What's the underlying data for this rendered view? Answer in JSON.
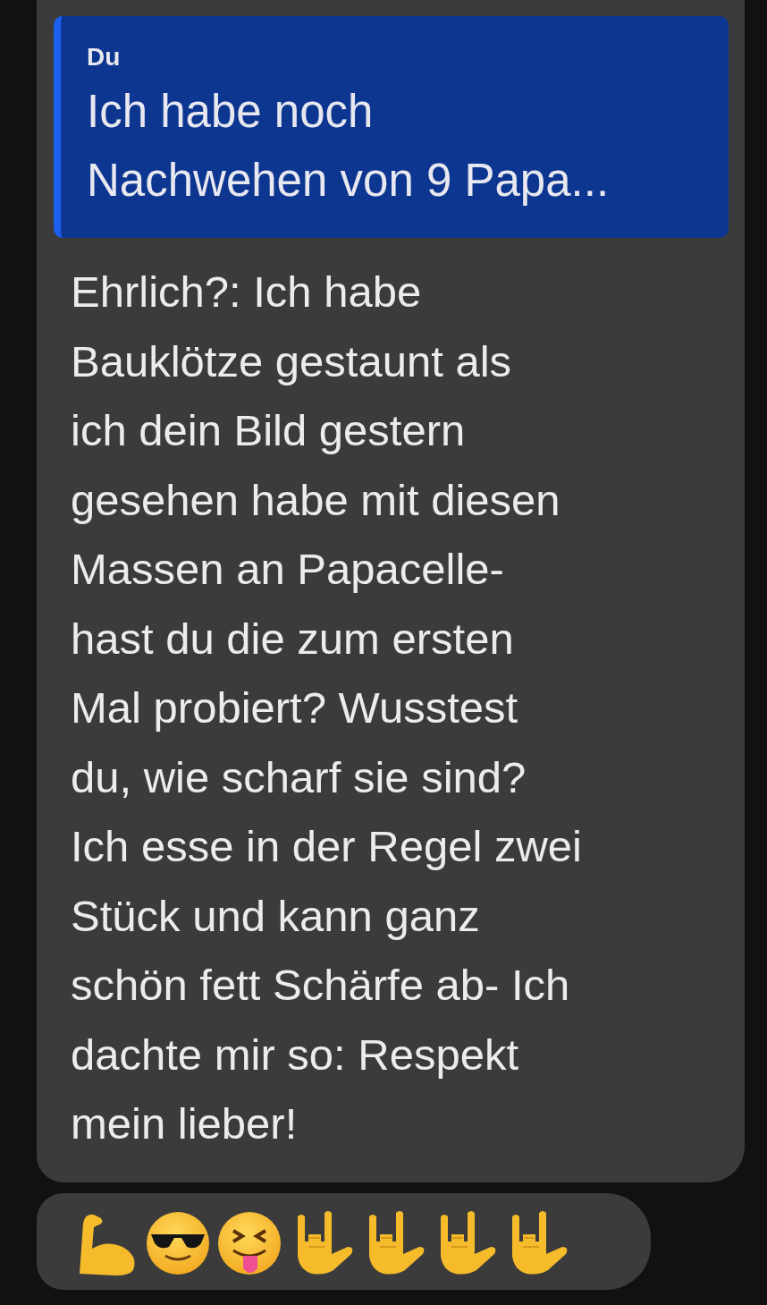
{
  "messages": [
    {
      "kind": "text",
      "quote": {
        "author": "Du",
        "lines": [
          "Ich habe noch",
          "Nachwehen von 9 Papa..."
        ]
      },
      "lines": [
        "Ehrlich?: Ich habe",
        "Bauklötze gestaunt als",
        "ich dein Bild gestern",
        "gesehen habe mit diesen",
        "Massen an Papacelle-",
        "hast du die zum ersten",
        "Mal probiert? Wusstest",
        "du, wie scharf sie sind?",
        "Ich esse in der Regel zwei",
        "Stück und kann ganz",
        "schön fett Schärfe ab- Ich",
        "dachte mir so: Respekt",
        "mein lieber!"
      ]
    },
    {
      "kind": "emoji",
      "emojis": [
        {
          "kind": "biceps"
        },
        {
          "kind": "sunglasses"
        },
        {
          "kind": "tongue"
        },
        {
          "kind": "horns"
        },
        {
          "kind": "horns"
        },
        {
          "kind": "horns"
        },
        {
          "kind": "horns"
        }
      ]
    }
  ]
}
